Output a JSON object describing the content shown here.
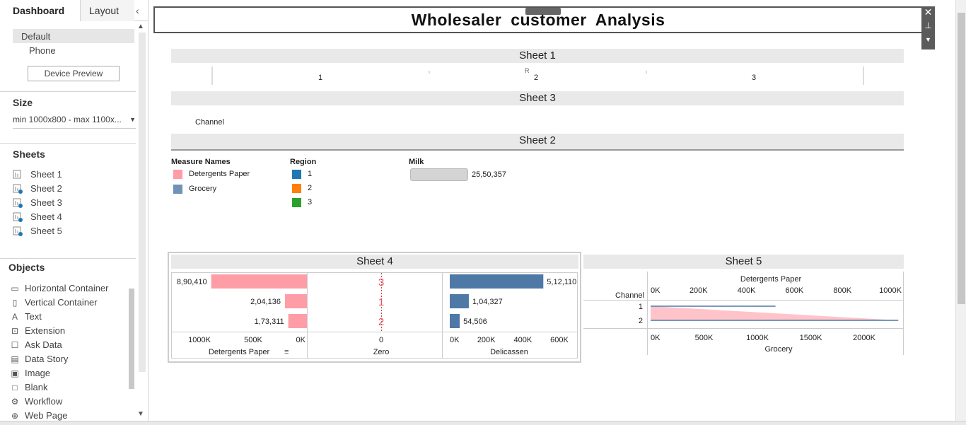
{
  "sidebar": {
    "tab_dashboard": "Dashboard",
    "tab_layout": "Layout",
    "device_default": "Default",
    "device_phone": "Phone",
    "device_preview": "Device Preview",
    "size_title": "Size",
    "size_value": "min 1000x800 - max 1100x...",
    "sheets_title": "Sheets",
    "sheets": [
      "Sheet 1",
      "Sheet 2",
      "Sheet 3",
      "Sheet 4",
      "Sheet 5"
    ],
    "objects_title": "Objects",
    "objects": [
      {
        "label": "Horizontal Container",
        "icon": "horizontal-container-icon"
      },
      {
        "label": "Vertical Container",
        "icon": "vertical-container-icon"
      },
      {
        "label": "Text",
        "icon": "text-icon"
      },
      {
        "label": "Extension",
        "icon": "extension-icon"
      },
      {
        "label": "Ask Data",
        "icon": "ask-data-icon"
      },
      {
        "label": "Data Story",
        "icon": "data-story-icon"
      },
      {
        "label": "Image",
        "icon": "image-icon"
      },
      {
        "label": "Blank",
        "icon": "blank-icon"
      },
      {
        "label": "Workflow",
        "icon": "workflow-icon"
      },
      {
        "label": "Web Page",
        "icon": "web-page-icon"
      }
    ]
  },
  "dashboard": {
    "title": "Wholesaler customer Analysis",
    "sheet1": {
      "title": "Sheet 1",
      "ticks": [
        "1",
        "2",
        "3"
      ],
      "cut_label": "R"
    },
    "sheet3": {
      "title": "Sheet 3",
      "field": "Channel"
    },
    "sheet2": {
      "title": "Sheet 2",
      "measure_title": "Measure Names",
      "measures": [
        {
          "label": "Detergents Paper",
          "color": "#ff9da7"
        },
        {
          "label": "Grocery",
          "color": "#6f92b5"
        }
      ],
      "region_title": "Region",
      "regions": [
        {
          "label": "1",
          "color": "#1f77b4"
        },
        {
          "label": "2",
          "color": "#ff7f0e"
        },
        {
          "label": "3",
          "color": "#2ca02c"
        }
      ],
      "milk_title": "Milk",
      "milk_value": "25,50,357",
      "milk_fraction": 1.0
    },
    "sheet4": {
      "title": "Sheet 4"
    },
    "sheet5": {
      "title": "Sheet 5"
    }
  },
  "chart_data": [
    {
      "type": "bar",
      "title": "Sheet 4",
      "categories": [
        "3",
        "1",
        "2"
      ],
      "series": [
        {
          "name": "Detergents Paper",
          "values": [
            890410,
            204136,
            173311
          ],
          "labels": [
            "8,90,410",
            "2,04,136",
            "1,73,311"
          ],
          "color": "#ff9da7"
        },
        {
          "name": "Delicassen",
          "values": [
            512110,
            104327,
            54506
          ],
          "labels": [
            "5,12,110",
            "1,04,327",
            "54,506"
          ],
          "color": "#4e79a7"
        }
      ],
      "left_axis": {
        "label": "Detergents Paper",
        "ticks": [
          "1000K",
          "500K",
          "0K"
        ],
        "range": [
          0,
          1000000
        ],
        "reversed": true
      },
      "middle_axis": {
        "label": "Zero",
        "ticks": [
          "0"
        ]
      },
      "right_axis": {
        "label": "Delicassen",
        "ticks": [
          "0K",
          "200K",
          "400K",
          "600K"
        ],
        "range": [
          0,
          600000
        ]
      }
    },
    {
      "type": "area",
      "title": "Sheet 5",
      "row_label": "Channel",
      "categories": [
        "1",
        "2"
      ],
      "top_axis": {
        "label": "Detergents Paper",
        "ticks": [
          "0K",
          "200K",
          "400K",
          "600K",
          "800K",
          "1000K"
        ],
        "range": [
          0,
          1000000
        ]
      },
      "bottom_axis": {
        "label": "Grocery",
        "ticks": [
          "0K",
          "500K",
          "1000K",
          "1500K",
          "2000K"
        ],
        "range": [
          0,
          2300000
        ]
      },
      "series": [
        {
          "name": "Detergents Paper",
          "values": [
            530000,
            1080000
          ],
          "color": "#4e79a7"
        },
        {
          "name": "Grocery",
          "values": [
            1170000,
            2320000
          ],
          "color": "#ff9da7"
        }
      ]
    }
  ]
}
